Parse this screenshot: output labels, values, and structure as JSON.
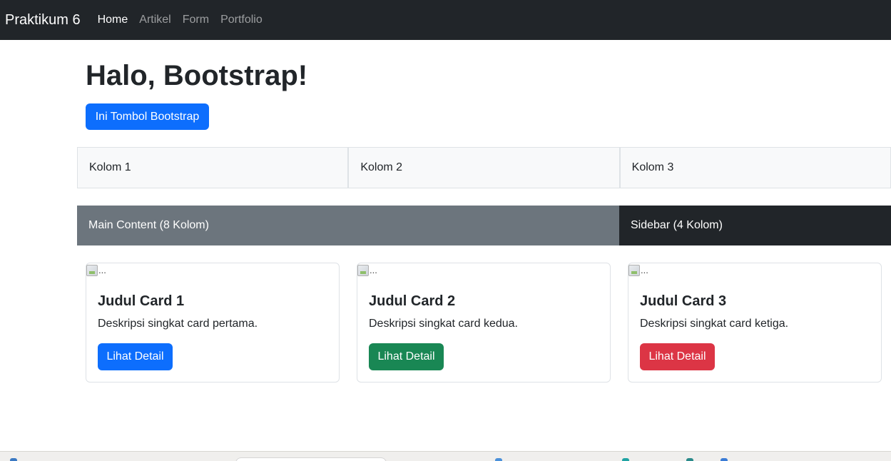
{
  "navbar": {
    "brand": "Praktikum 6",
    "links": [
      {
        "label": "Home",
        "active": true
      },
      {
        "label": "Artikel",
        "active": false
      },
      {
        "label": "Form",
        "active": false
      },
      {
        "label": "Portfolio",
        "active": false
      }
    ]
  },
  "hero": {
    "title": "Halo, Bootstrap!",
    "button_label": "Ini Tombol Bootstrap"
  },
  "columns": [
    "Kolom 1",
    "Kolom 2",
    "Kolom 3"
  ],
  "layout": {
    "main_label": "Main Content (8 Kolom)",
    "sidebar_label": "Sidebar (4 Kolom)"
  },
  "cards": [
    {
      "img_alt": "...",
      "title": "Judul Card 1",
      "text": "Deskripsi singkat card pertama.",
      "button": "Lihat Detail",
      "button_color": "#0d6efd"
    },
    {
      "img_alt": "...",
      "title": "Judul Card 2",
      "text": "Deskripsi singkat card kedua.",
      "button": "Lihat Detail",
      "button_color": "#198754"
    },
    {
      "img_alt": "...",
      "title": "Judul Card 3",
      "text": "Deskripsi singkat card ketiga.",
      "button": "Lihat Detail",
      "button_color": "#dc3545"
    }
  ],
  "colors": {
    "navbar_bg": "#212529",
    "primary": "#0d6efd",
    "secondary": "#6c757d",
    "success": "#198754",
    "danger": "#dc3545",
    "light": "#f8f9fa"
  }
}
